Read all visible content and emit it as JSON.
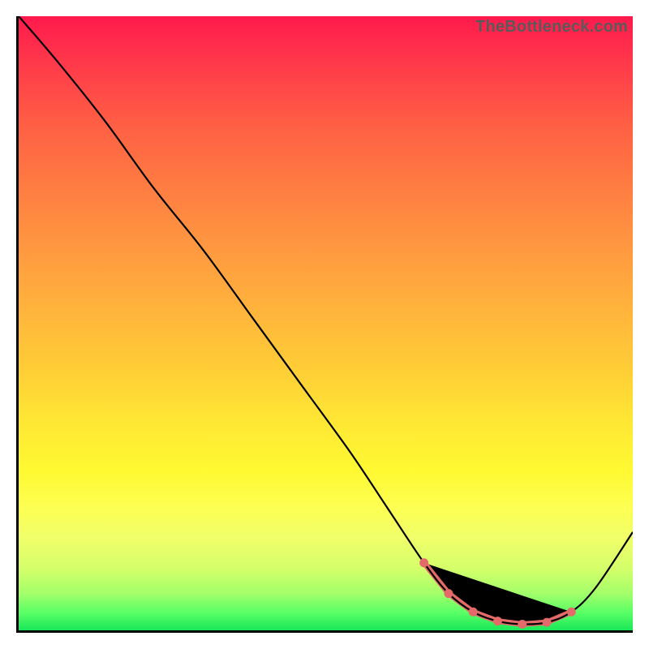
{
  "watermark": "TheBottleneck.com",
  "chart_data": {
    "type": "line",
    "title": "",
    "xlabel": "",
    "ylabel": "",
    "xlim": [
      0,
      100
    ],
    "ylim": [
      0,
      100
    ],
    "grid": false,
    "series": [
      {
        "name": "curve",
        "x": [
          0,
          6,
          14,
          22,
          30,
          38,
          46,
          54,
          60,
          66,
          70,
          74,
          78,
          82,
          86,
          90,
          94,
          100
        ],
        "values": [
          100,
          93,
          83,
          72,
          62,
          51,
          40,
          29,
          20,
          11,
          6,
          3,
          1.5,
          1,
          1.3,
          3,
          7,
          16
        ]
      }
    ],
    "highlight_range": {
      "x": [
        66,
        70,
        74,
        78,
        82,
        86,
        90
      ],
      "values": [
        11,
        6,
        3,
        1.5,
        1,
        1.3,
        3
      ]
    },
    "colors": {
      "curve": "#000000",
      "highlight": "#e46a6a"
    }
  }
}
